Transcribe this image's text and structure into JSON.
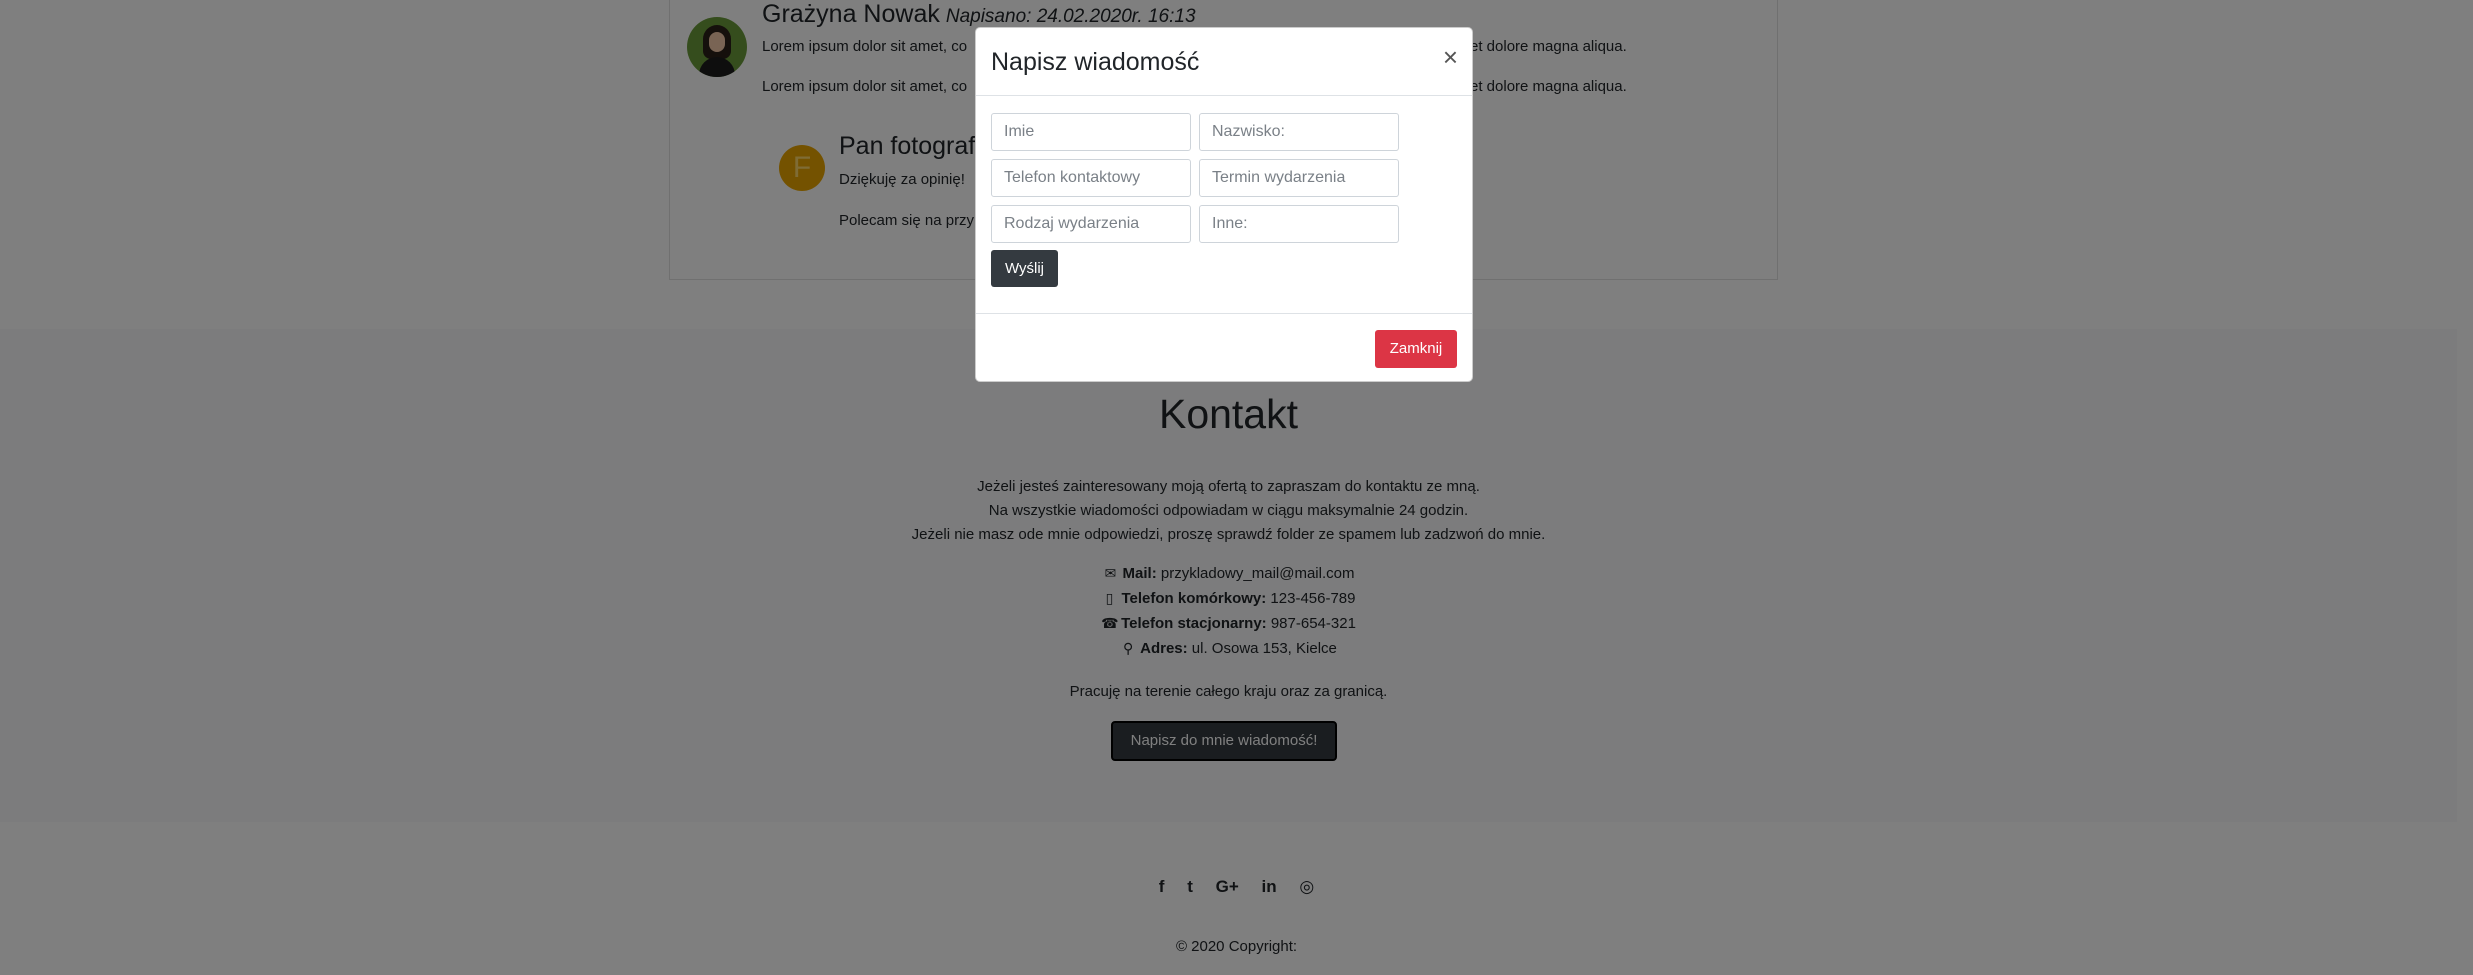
{
  "comments": [
    {
      "author": "Grażyna Nowak",
      "date": "Napisano: 24.02.2020r. 16:13",
      "line1_start": "Lorem ipsum dolor sit amet, co",
      "line1_end": "et dolore magna aliqua.",
      "line2_start": "Lorem ipsum dolor sit amet, co",
      "line2_end": "et dolore magna aliqua."
    },
    {
      "author": "Pan fotograf",
      "avatar_letter": "F",
      "line1": "Dziękuję za opinię!",
      "line2": "Polecam się na przy"
    }
  ],
  "contact": {
    "title": "Kontakt",
    "intro": [
      "Jeżeli jesteś zainteresowany moją ofertą to zapraszam do kontaktu ze mną.",
      "Na wszystkie wiadomości odpowiadam w ciągu maksymalnie 24 godzin.",
      "Jeżeli nie masz ode mnie odpowiedzi, proszę sprawdź folder ze spamem lub zadzwoń do mnie."
    ],
    "details": [
      {
        "icon": "envelope-icon",
        "label": "Mail:",
        "value": "przykladowy_mail@mail.com"
      },
      {
        "icon": "mobile-phone-icon",
        "label": "Telefon komórkowy:",
        "value": "123-456-789"
      },
      {
        "icon": "phone-icon",
        "label": "Telefon stacjonarny:",
        "value": "987-654-321"
      },
      {
        "icon": "map-marker-icon",
        "label": "Adres:",
        "value": "ul. Osowa 153, Kielce"
      }
    ],
    "area": "Pracuję na terenie całego kraju oraz za granicą.",
    "write_button": "Napisz do mnie wiadomość!"
  },
  "footer": {
    "social": [
      "facebook-icon",
      "twitter-icon",
      "google-plus-icon",
      "linkedin-icon",
      "dribbble-icon"
    ],
    "copyright": "© 2020 Copyright:"
  },
  "modal": {
    "title": "Napisz wiadomość",
    "close_symbol": "×",
    "fields": {
      "first_name": "Imie",
      "last_name": "Nazwisko:",
      "phone": "Telefon kontaktowy",
      "event_date": "Termin wydarzenia",
      "event_type": "Rodzaj wydarzenia",
      "other": "Inne:"
    },
    "send_label": "Wyślij",
    "close_label": "Zamknij"
  },
  "colors": {
    "danger": "#dc3545",
    "dark": "#343a40",
    "backdrop": "rgba(0,0,0,0.5)"
  }
}
